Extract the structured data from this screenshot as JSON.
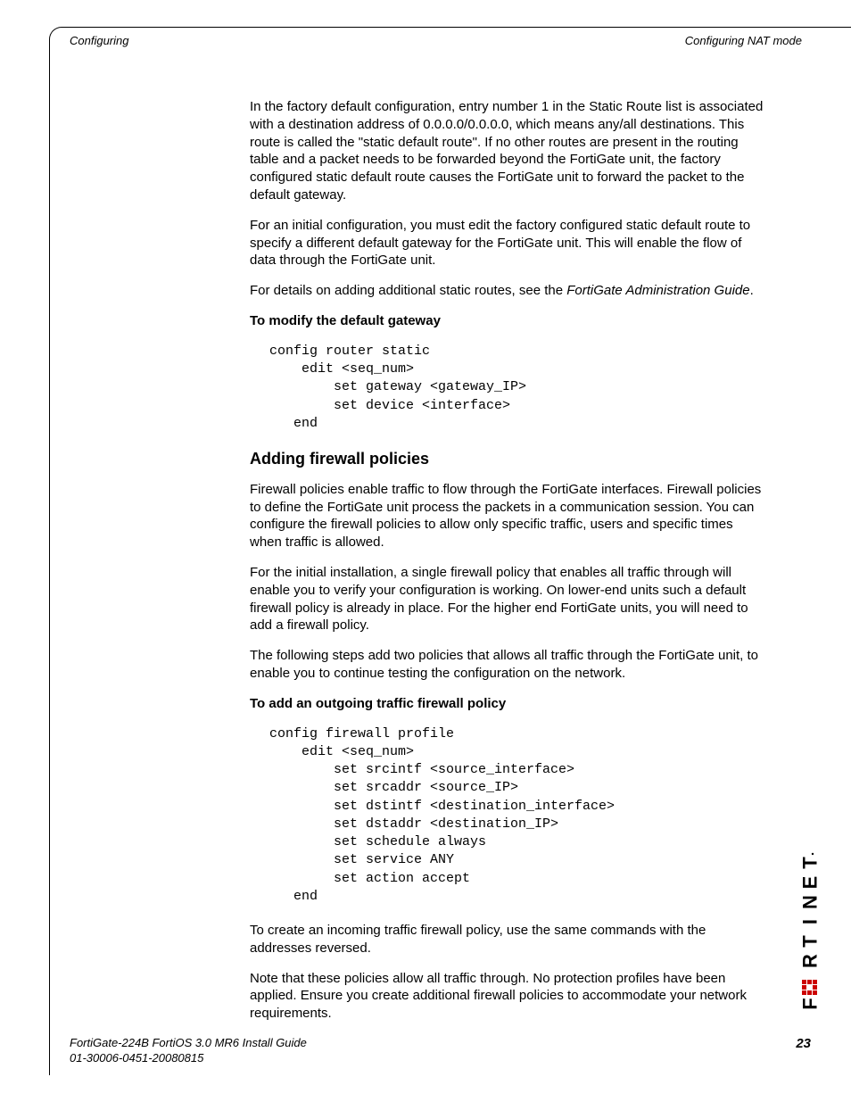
{
  "header": {
    "left": "Configuring",
    "right": "Configuring NAT mode"
  },
  "body": {
    "p1": "In the factory default configuration, entry number 1 in the Static Route list is associated with a destination address of 0.0.0.0/0.0.0.0, which means any/all destinations. This route is called the \"static default route\". If no other routes are present in the routing table and a packet needs to be forwarded beyond the FortiGate unit, the factory configured static default route causes the FortiGate unit to forward the packet to the default gateway.",
    "p2": "For an initial configuration, you must edit the factory configured static default route to specify a different default gateway for the FortiGate unit. This will enable the flow of data through the FortiGate unit.",
    "p3a": "For details on adding additional static routes, see the ",
    "p3b": "FortiGate Administration Guide",
    "p3c": ".",
    "h1": "To modify the default gateway",
    "code1": "config router static\n    edit <seq_num>\n        set gateway <gateway_IP>\n        set device <interface>\n   end",
    "section": "Adding firewall policies",
    "p4": "Firewall policies enable traffic to flow through the FortiGate interfaces. Firewall policies to define the FortiGate unit process the packets in a communication session. You can configure the firewall policies to allow only specific traffic, users and specific times when traffic is allowed.",
    "p5": "For the initial installation, a single firewall policy that enables all traffic through will enable you to verify your configuration is working. On lower-end units such a default firewall policy is already in place. For the higher end FortiGate units, you will need to add a firewall policy.",
    "p6": "The following steps add two policies that allows all traffic through the FortiGate unit, to enable you to continue testing the configuration on the network.",
    "h2": "To add an outgoing traffic firewall policy",
    "code2": "config firewall profile\n    edit <seq_num>\n        set srcintf <source_interface>\n        set srcaddr <source_IP>\n        set dstintf <destination_interface>\n        set dstaddr <destination_IP>\n        set schedule always\n        set service ANY\n        set action accept\n   end",
    "p7": "To create an incoming traffic firewall policy, use the same commands with the addresses reversed.",
    "p8": "Note that these policies allow all traffic through. No protection profiles have been applied. Ensure you create additional firewall policies to accommodate your network requirements."
  },
  "footer": {
    "line1": "FortiGate-224B FortiOS 3.0 MR6 Install Guide",
    "line2": "01-30006-0451-20080815",
    "page": "23"
  },
  "logo": "FORTINET"
}
